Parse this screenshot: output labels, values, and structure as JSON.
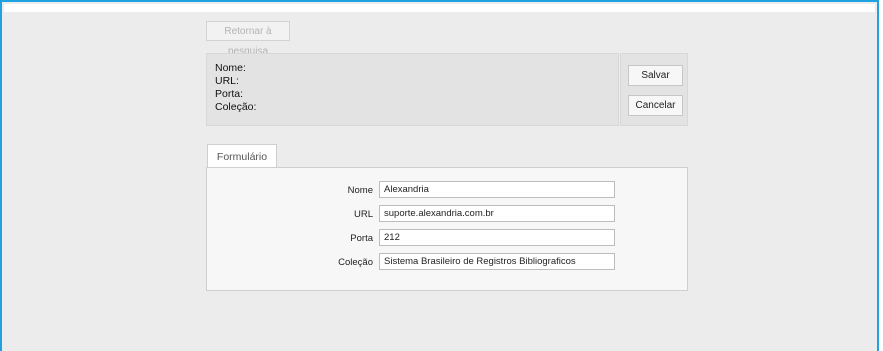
{
  "nav": {
    "return_label": "Retornar à pesquisa"
  },
  "summary": {
    "rows": [
      "Nome:",
      "URL:",
      "Porta:",
      "Coleção:"
    ]
  },
  "actions": {
    "save_label": "Salvar",
    "cancel_label": "Cancelar"
  },
  "form": {
    "tab_label": "Formulário",
    "fields": [
      {
        "label": "Nome",
        "value": "Alexandria"
      },
      {
        "label": "URL",
        "value": "suporte.alexandria.com.br"
      },
      {
        "label": "Porta",
        "value": "212"
      },
      {
        "label": "Coleção",
        "value": "Sistema Brasileiro de Registros Bibliograficos"
      }
    ]
  },
  "colors": {
    "frame_border": "#1ea3e0",
    "background": "#ececec",
    "panel": "#e3e3e3"
  }
}
